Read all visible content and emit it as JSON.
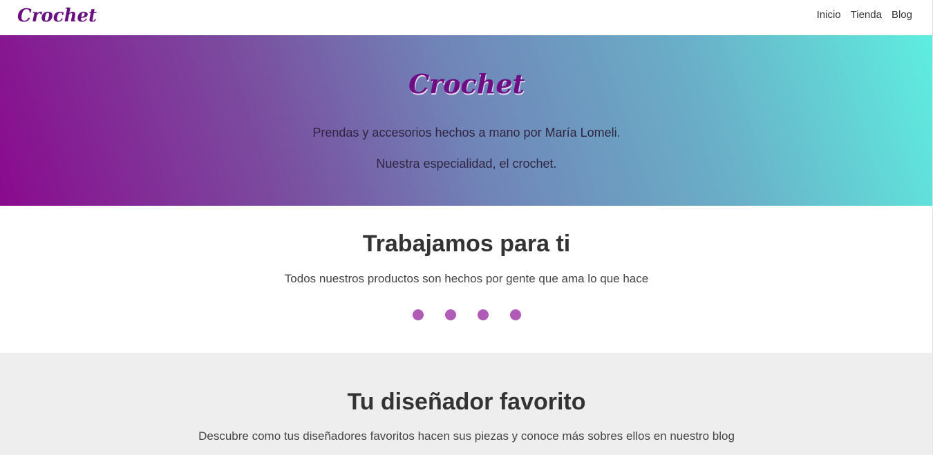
{
  "navbar": {
    "logo": "Crochet",
    "links": [
      "Inicio",
      "Tienda",
      "Blog"
    ]
  },
  "hero": {
    "title": "Crochet",
    "line1": "Prendas y accesorios hechos a mano por María Lomeli.",
    "line2": "Nuestra especialidad, el crochet."
  },
  "work": {
    "title": "Trabajamos para ti",
    "subtitle": "Todos nuestros productos son hechos por gente que ama lo que hace",
    "dots_count": 4
  },
  "designer": {
    "title": "Tu diseñador favorito",
    "subtitle": "Descubre como tus diseñadores favoritos hacen sus piezas y conoce más sobres ellos en nuestro blog"
  },
  "colors": {
    "brand": "#6e0e84",
    "dot": "#b05bb8",
    "gradient_start": "#8a0a8e",
    "gradient_end": "#5eeee0",
    "section_gray": "#eeeeee"
  }
}
